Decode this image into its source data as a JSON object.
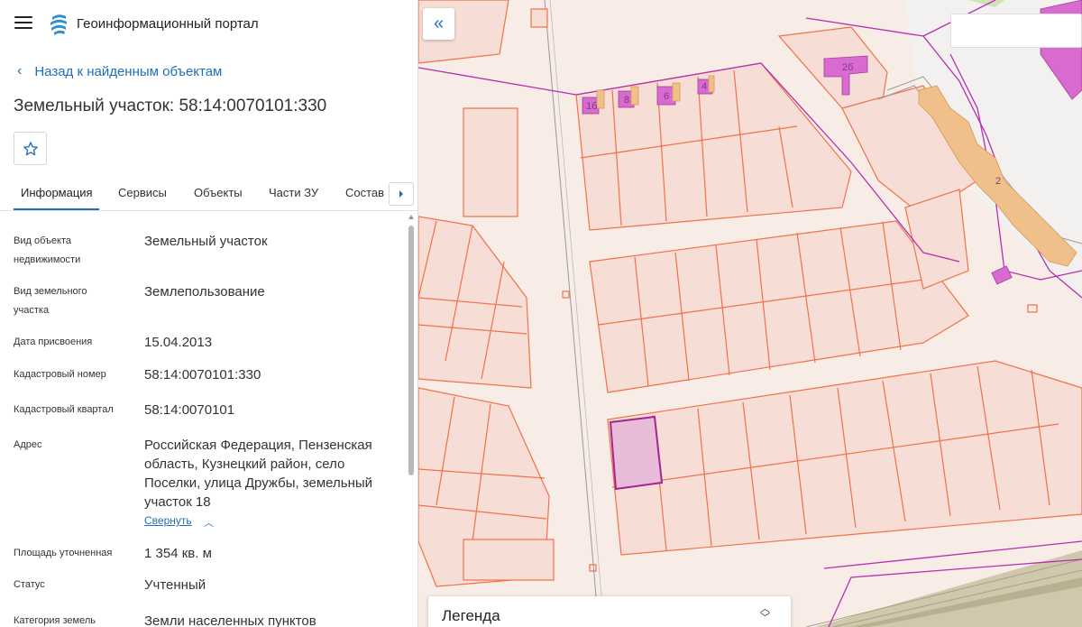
{
  "header": {
    "portal_title": "Геоинформационный портал"
  },
  "nav": {
    "back_label": "Назад к найденным объектам"
  },
  "object": {
    "title": "Земельный участок: 58:14:0070101:330"
  },
  "tabs": [
    {
      "label": "Информация",
      "active": true
    },
    {
      "label": "Сервисы"
    },
    {
      "label": "Объекты"
    },
    {
      "label": "Части ЗУ"
    },
    {
      "label": "Состав"
    }
  ],
  "info": [
    {
      "label": "Вид объекта\nнедвижимости",
      "value": "Земельный участок"
    },
    {
      "label": "Вид земельного\nучастка",
      "value": "Землепользование"
    },
    {
      "label": "Дата присвоения",
      "value": "15.04.2013"
    },
    {
      "label": "Кадастровый номер",
      "value": "58:14:0070101:330"
    },
    {
      "label": "Кадастровый квартал",
      "value": "58:14:0070101"
    },
    {
      "label": "Адрес",
      "value": "Российская Федерация, Пензенская область, Кузнецкий район, село Поселки, улица Дружбы, земельный участок 18"
    },
    {
      "label": "Площадь уточненная",
      "value": "1 354 кв. м"
    },
    {
      "label": "Статус",
      "value": "Учтенный"
    },
    {
      "label": "Категория земель",
      "value": "Земли населенных пунктов"
    }
  ],
  "address_collapse_label": "Свернуть",
  "map": {
    "building_labels": [
      "1б",
      "8",
      "6",
      "4",
      "2б",
      "2"
    ],
    "legend_label": "Легенда",
    "colors": {
      "parcel_stroke": "#f0724a",
      "parcel_fill": "#f6ddd6",
      "boundary_magenta": "#b62fb0",
      "building_fill": "#d96ad0",
      "building_orange": "#f0b37a",
      "selected_fill": "#e8bcd8",
      "road": "#c9c1a6"
    }
  },
  "colors": {
    "accent": "#1e6fb8"
  }
}
